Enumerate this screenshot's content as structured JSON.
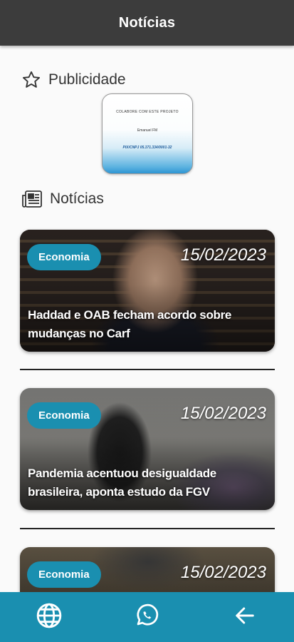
{
  "appbar": {
    "title": "Notícias"
  },
  "ad_section": {
    "title": "Publicidade",
    "icon": "star-outline-icon",
    "banner": {
      "line1": "COLABORE COM ESTE PROJETO",
      "line2": "Emanuel FM",
      "line3": "PIX/CNPJ 05.171.334/0001-32"
    }
  },
  "news_section": {
    "title": "Notícias",
    "icon": "newspaper-icon"
  },
  "news": [
    {
      "category": "Economia",
      "date": "15/02/2023",
      "headline": "Haddad e OAB fecham acordo sobre mudanças no Carf"
    },
    {
      "category": "Economia",
      "date": "15/02/2023",
      "headline": "Pandemia acentuou desigualdade brasileira, aponta estudo da FGV"
    },
    {
      "category": "Economia",
      "date": "15/02/2023",
      "headline": ""
    }
  ],
  "bottom_nav": [
    {
      "icon": "globe-icon"
    },
    {
      "icon": "whatsapp-icon"
    },
    {
      "icon": "arrow-back-icon"
    }
  ],
  "colors": {
    "appbar": "#3c3c3c",
    "accent": "#1a8fb0",
    "background": "#fafafa"
  }
}
